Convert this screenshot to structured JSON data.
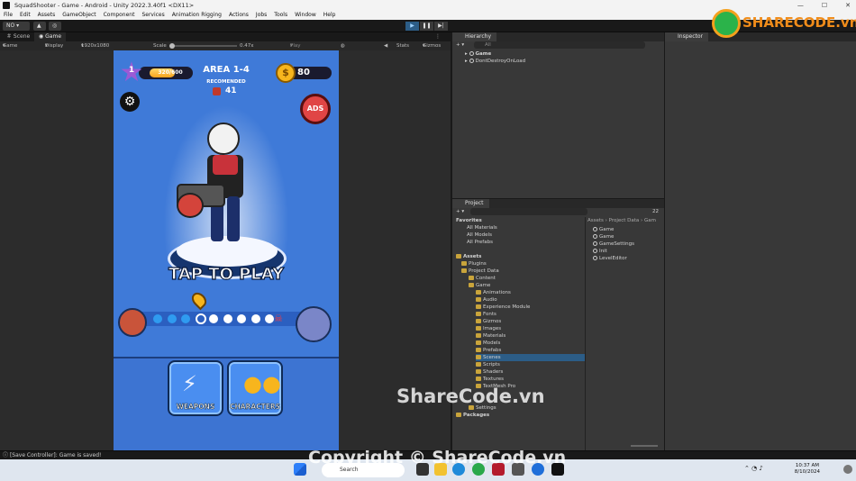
{
  "window": {
    "title": "SquadShooter - Game - Android - Unity 2022.3.40f1 <DX11>"
  },
  "menu": [
    "File",
    "Edit",
    "Assets",
    "GameObject",
    "Component",
    "Services",
    "Animation Rigging",
    "Actions",
    "Jobs",
    "Tools",
    "Window",
    "Help"
  ],
  "toolbar": {
    "account": "NO",
    "cloud": "▲",
    "search": "◎"
  },
  "tabs": {
    "scene": "Scene",
    "game": "Game"
  },
  "gamebar": {
    "mode": "Game",
    "display": "Display 1",
    "resolution": "1920x1080 Portrait",
    "scale_label": "Scale",
    "scale_value": "0.47x",
    "play_focused": "Play Focused",
    "stats": "Stats",
    "gizmos": "Gizmos"
  },
  "game": {
    "level": "1",
    "xp": "320/600",
    "area": "AREA 1-4",
    "recommended": "RECOMENDED",
    "recommended_value": "41",
    "coins": "80",
    "ads": "ADS",
    "tap": "TAP TO PLAY",
    "weapons": "WEAPONS",
    "characters": "CHARACTERS",
    "stage_progress_filled": 3,
    "stage_total": 9
  },
  "hierarchy": {
    "title": "Hierarchy",
    "search_placeholder": "All",
    "items": [
      "Game",
      "DontDestroyOnLoad"
    ]
  },
  "project": {
    "title": "Project",
    "count": "22",
    "favorites": {
      "label": "Favorites",
      "items": [
        "All Materials",
        "All Models",
        "All Prefabs"
      ]
    },
    "assets_label": "Assets",
    "tree": [
      "Plugins",
      "Project Data",
      "Content",
      "Game",
      "Animations",
      "Audio",
      "Experience Module",
      "Fonts",
      "Gizmos",
      "Images",
      "Materials",
      "Models",
      "Prefabs",
      "Scenes",
      "Scripts",
      "Shaders",
      "Textures",
      "TextMesh Pro",
      "Settings"
    ],
    "packages_label": "Packages",
    "breadcrumb": "Assets › Project Data › Gam",
    "files": [
      "Game",
      "Game",
      "GameSettings",
      "Init",
      "LevelEditor"
    ]
  },
  "inspector": {
    "title": "Inspector"
  },
  "status": {
    "message": "[Save Controller]: Game is saved!"
  },
  "taskbar": {
    "search": "Search",
    "time": "10:37 AM",
    "date": "8/10/2024"
  },
  "watermark": {
    "logo": "SHARECODE.vn",
    "center": "ShareCode.vn",
    "copyright": "Copyright © ShareCode.vn"
  },
  "colors": {
    "accent": "#2c5d87",
    "game_bg": "#3f7ad8",
    "gold": "#f7b51d"
  }
}
